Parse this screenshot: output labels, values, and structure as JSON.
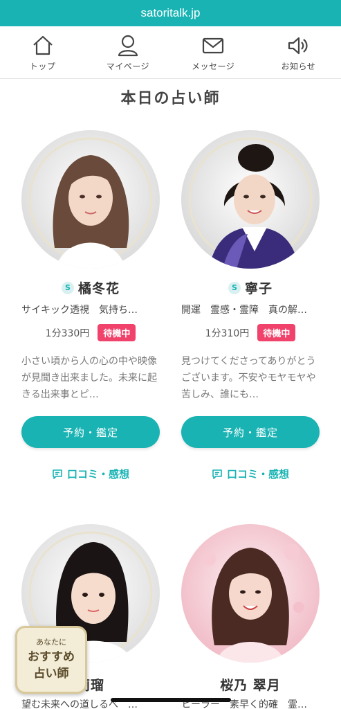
{
  "browser": {
    "url": "satoritalk.jp"
  },
  "nav": {
    "items": [
      {
        "label": "トップ",
        "icon": "home-icon"
      },
      {
        "label": "マイページ",
        "icon": "user-icon"
      },
      {
        "label": "メッセージ",
        "icon": "mail-icon"
      },
      {
        "label": "お知らせ",
        "icon": "speaker-icon"
      }
    ]
  },
  "section": {
    "title": "本日の占い師"
  },
  "fortune_tellers": [
    {
      "badge": "S",
      "name": "橘冬花",
      "categories": "サイキック透視　気持ち…",
      "price": "1分330円",
      "status": "待機中",
      "description": "小さい頃から人の心の中や映像が見聞き出来ました。未来に起きる出来事とピ…",
      "book_label": "予約・鑑定",
      "review_label": "口コミ・感想"
    },
    {
      "badge": "S",
      "name": "寧子",
      "categories": "開運　霊感・霊障　真の解…",
      "price": "1分310円",
      "status": "待機中",
      "description": "見つけてくださってありがとうございます。不安やモヤモヤや苦しみ、誰にも…",
      "book_label": "予約・鑑定",
      "review_label": "口コミ・感想"
    },
    {
      "name": "莉瑠",
      "categories": "望む未来への道しるべ　…"
    },
    {
      "name": "桜乃 翠月",
      "categories": "ヒーラー　素早く的確　霊…"
    }
  ],
  "recommend_badge": {
    "small": "あなたに",
    "line1": "おすすめ",
    "line2": "占い師"
  },
  "colors": {
    "accent": "#19b3b4",
    "status": "#f0426b"
  }
}
